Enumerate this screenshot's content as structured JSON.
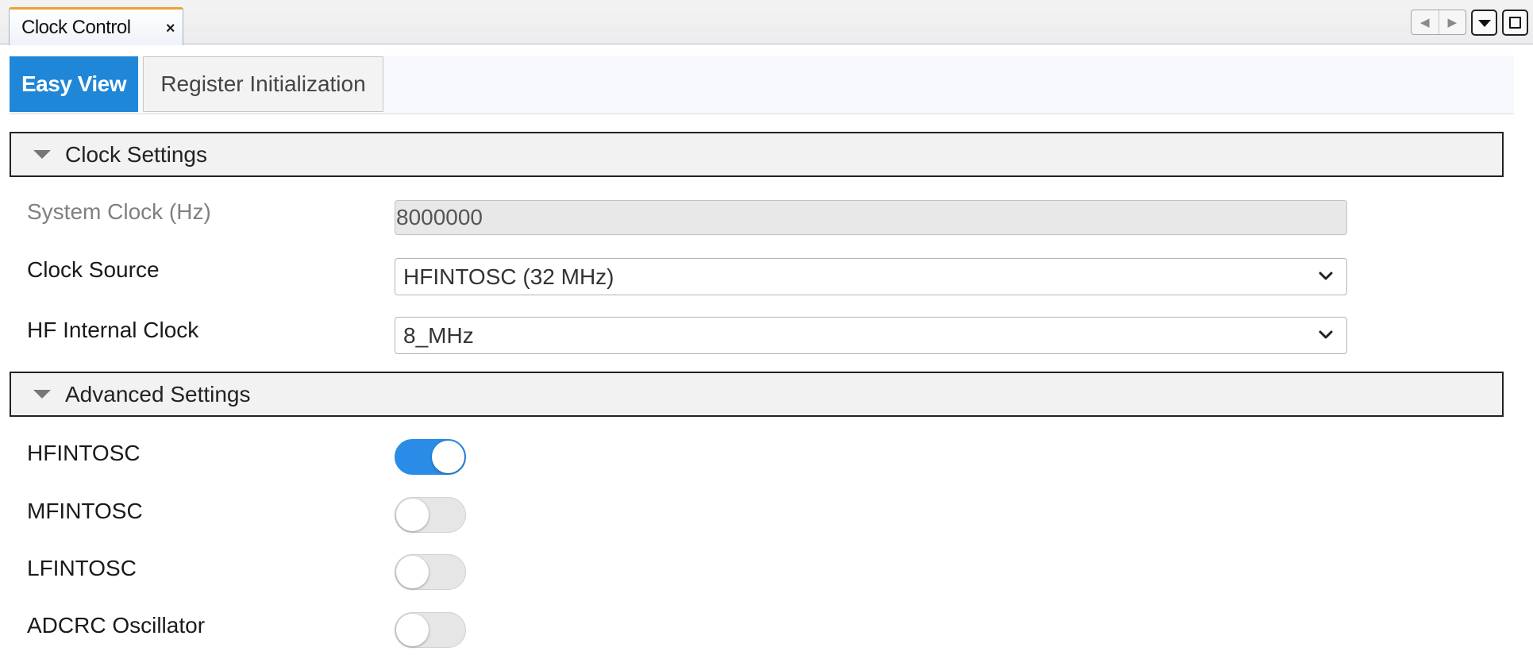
{
  "view_tab": {
    "title": "Clock Control",
    "close": "×"
  },
  "window_controls": {
    "nav_left": "◀",
    "nav_right": "▶"
  },
  "subtabs": [
    {
      "label": "Easy View",
      "active": true
    },
    {
      "label": "Register Initialization",
      "active": false
    }
  ],
  "clock_settings": {
    "header": "Clock Settings",
    "system_clock": {
      "label": "System Clock (Hz)",
      "value": "8000000"
    },
    "clock_source": {
      "label": "Clock Source",
      "value": "HFINTOSC (32 MHz)"
    },
    "hf_internal_clock": {
      "label": "HF Internal Clock",
      "value": "8_MHz"
    }
  },
  "advanced_settings": {
    "header": "Advanced Settings",
    "hfintosc": {
      "label": "HFINTOSC",
      "enabled": true
    },
    "mfintosc": {
      "label": "MFINTOSC",
      "enabled": false
    },
    "lfintosc": {
      "label": "LFINTOSC",
      "enabled": false
    },
    "adcrc": {
      "label": "ADCRC Oscillator",
      "enabled": false
    }
  },
  "colors": {
    "active_tab": "#1f86d8",
    "toggle_on": "#2a8ce6",
    "toggle_off": "#e6e6e6",
    "tab_accent": "#f0a030"
  }
}
